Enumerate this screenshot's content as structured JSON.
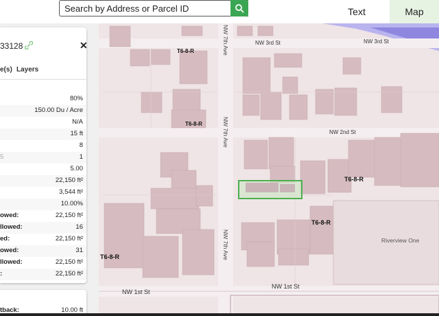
{
  "search": {
    "placeholder": "Search by Address or Parcel ID"
  },
  "tabs": {
    "text": "Text",
    "map": "Map"
  },
  "colors": {
    "accent": "#3aa653",
    "map_tab_bg": "#e6f3e3",
    "parcel_outline": "#4caf50"
  },
  "panel": {
    "title": "33128",
    "tab_left": "e(s)",
    "tab_layers": "Layers",
    "rows": [
      {
        "label": "",
        "value": "80%"
      },
      {
        "label": "",
        "value": "150.00 Du / Acre"
      },
      {
        "label": "",
        "value": "N/A"
      },
      {
        "label": "",
        "value": "15 ft"
      },
      {
        "label": "",
        "value": "8"
      },
      {
        "label": "5",
        "value": "1"
      },
      {
        "label": "",
        "value": "5.00"
      },
      {
        "label": "",
        "value": "22,150 ft²"
      },
      {
        "label": "",
        "value": "3,544 ft²"
      },
      {
        "label": "",
        "value": "10.00%"
      },
      {
        "label": "owed:",
        "value": "22,150 ft²"
      },
      {
        "label": "llowed:",
        "value": "16"
      },
      {
        "label": "ed:",
        "value": "22,150 ft²"
      },
      {
        "label": "owed:",
        "value": "31"
      },
      {
        "label": "llowed:",
        "value": "22,150 ft²"
      },
      {
        "label": ":",
        "value": "22,150 ft²"
      }
    ],
    "card2": {
      "label": "tback:",
      "value": "10.00 ft"
    }
  },
  "map": {
    "streets": {
      "nw3rd_a": "NW 3rd St",
      "nw3rd_b": "NW 3rd St",
      "nw2nd": "NW 2nd St",
      "nw1st": "NW 1st St",
      "nw1st_b": "NW 1st St",
      "nw7th_a": "NW 7th Ave",
      "nw7th_b": "NW 7th Ave",
      "nw7th_c": "NW 7th Ave"
    },
    "zones": {
      "z1": "T6-8-R",
      "z2": "T6-8-R",
      "z3": "T6-8-R",
      "z4": "T6-8-R",
      "z5": "T6-8-R"
    },
    "poi": "Riverview One"
  }
}
